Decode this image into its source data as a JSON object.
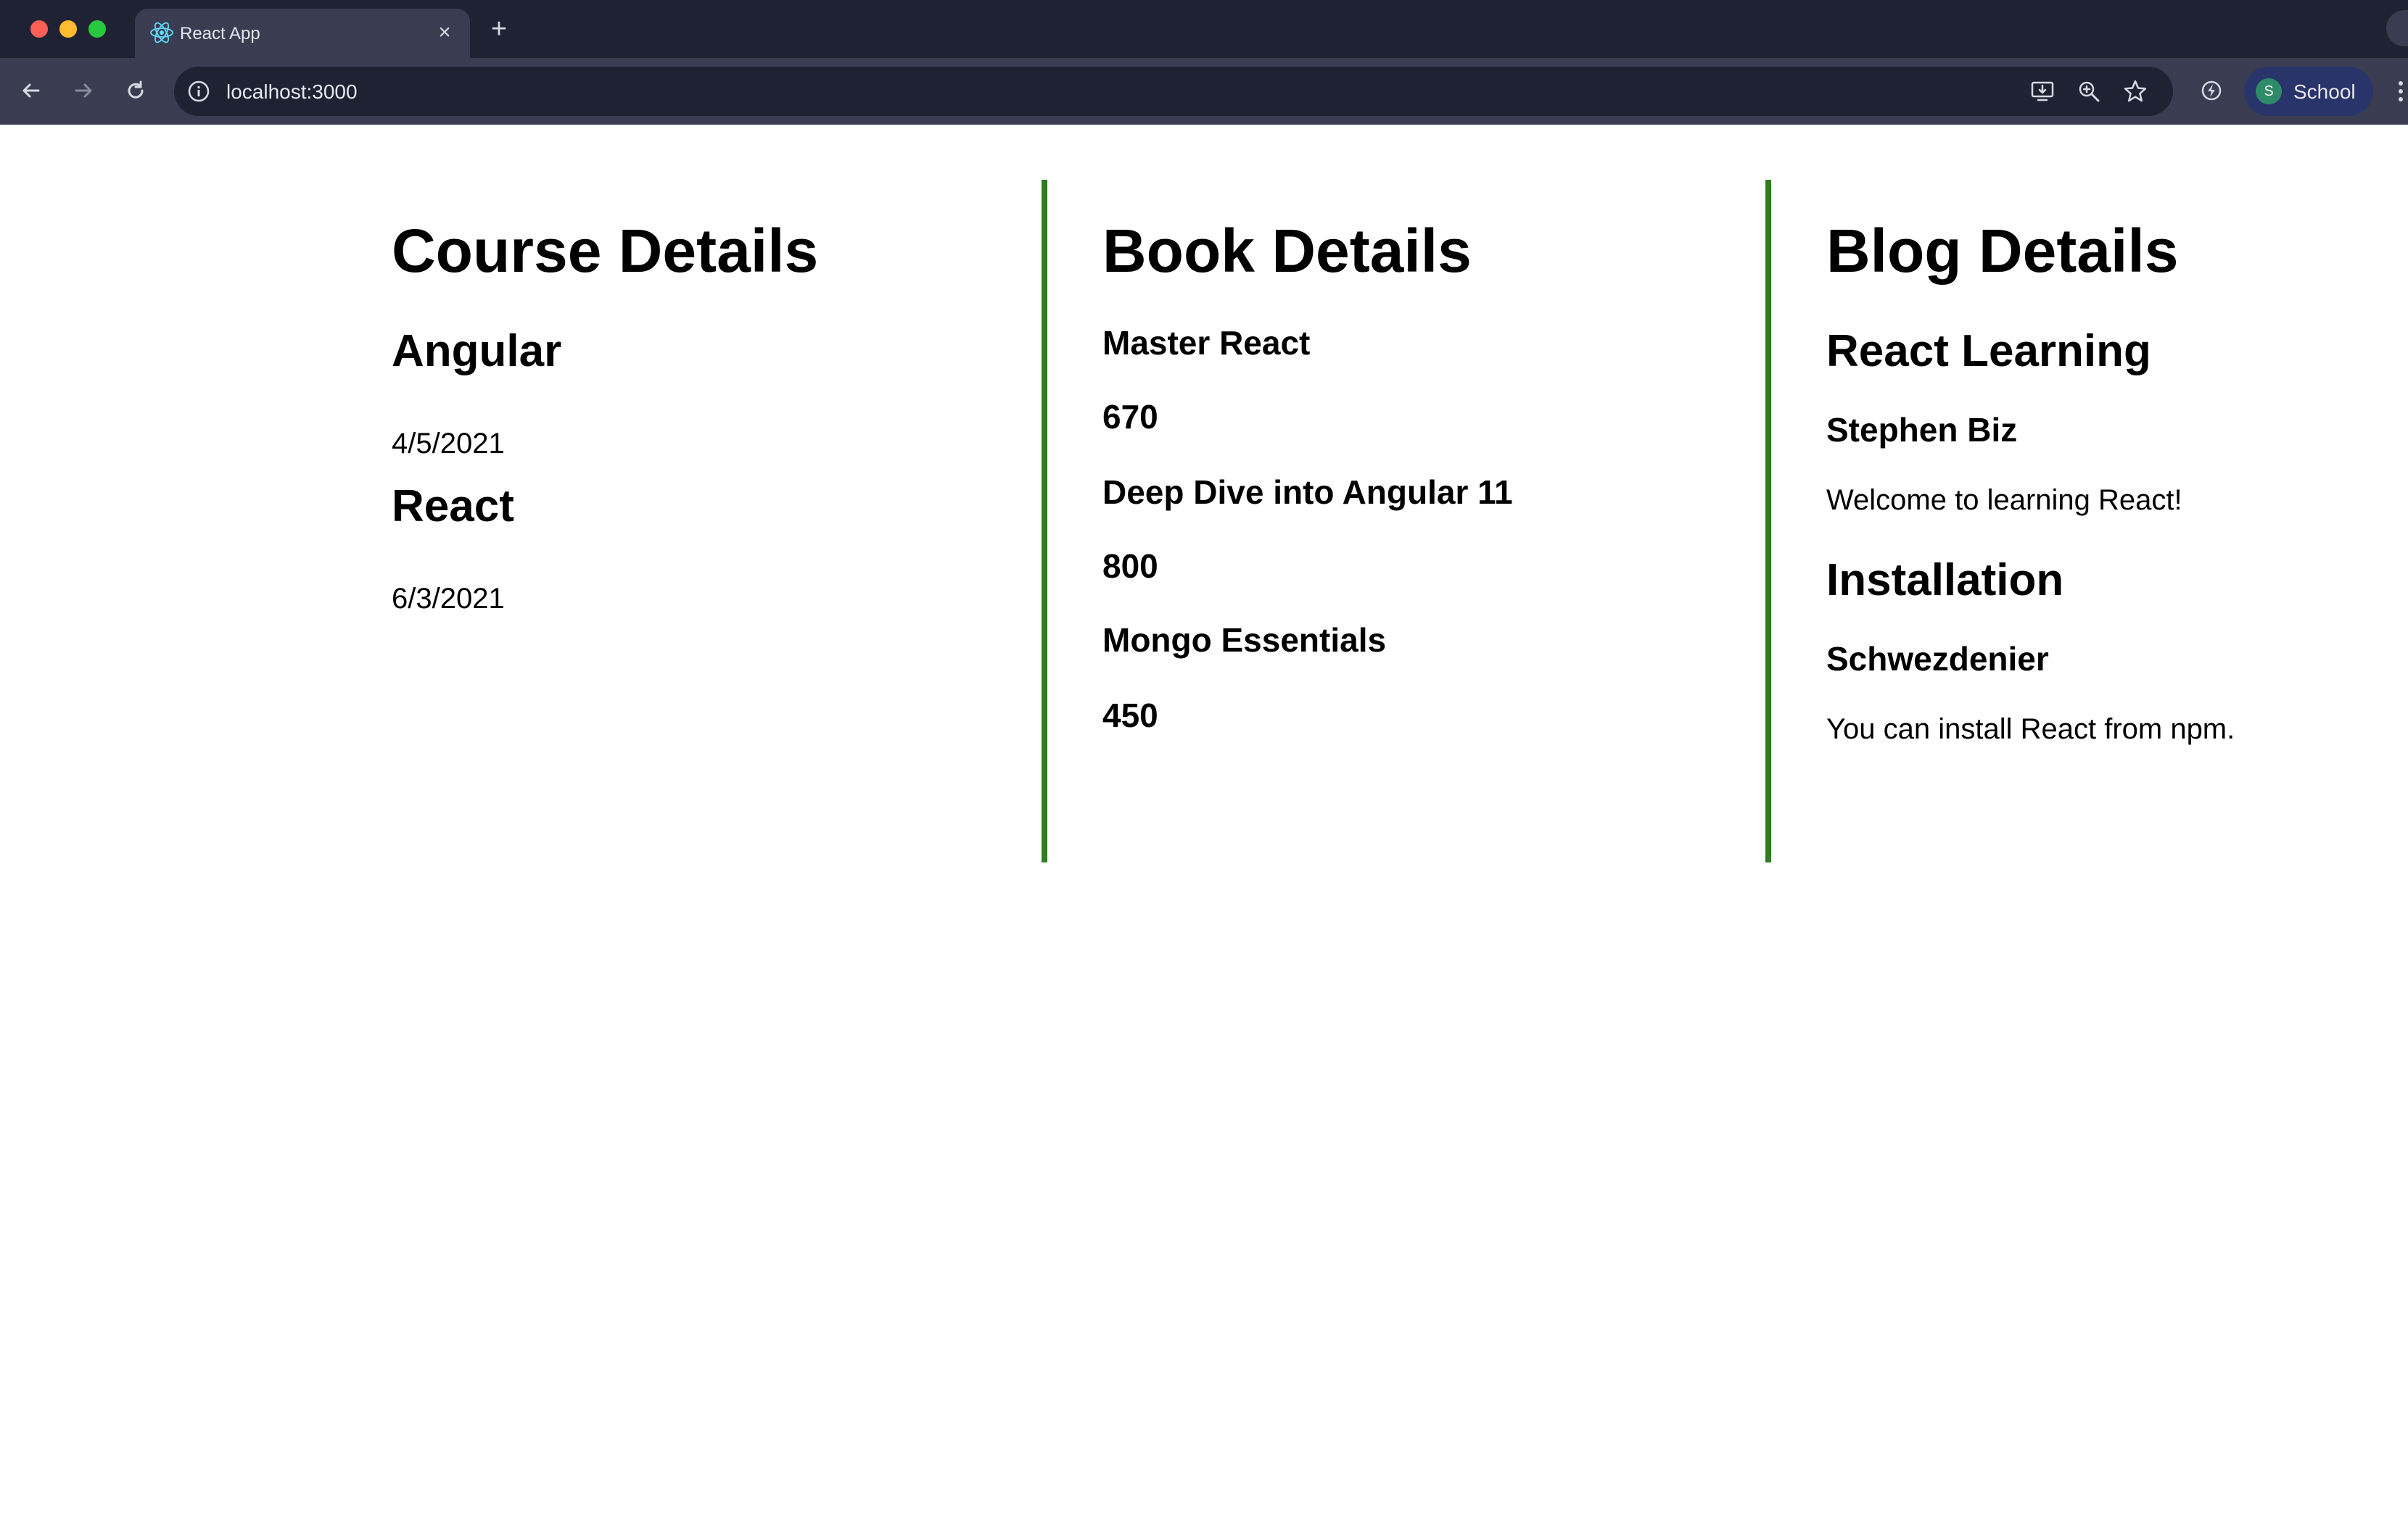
{
  "browser": {
    "tab_title": "React App",
    "url": "localhost:3000",
    "profile_initial": "S",
    "profile_name": "School"
  },
  "course_details": {
    "heading": "Course Details",
    "courses": [
      {
        "name": "Angular",
        "date": "4/5/2021"
      },
      {
        "name": "React",
        "date": "6/3/2021"
      }
    ]
  },
  "book_details": {
    "heading": "Book Details",
    "books": [
      {
        "name": "Master React",
        "price": "670"
      },
      {
        "name": "Deep Dive into Angular 11",
        "price": "800"
      },
      {
        "name": "Mongo Essentials",
        "price": "450"
      }
    ]
  },
  "blog_details": {
    "heading": "Blog Details",
    "blogs": [
      {
        "title": "React Learning",
        "author": "Stephen Biz",
        "content": "Welcome to learning React!"
      },
      {
        "title": "Installation",
        "author": "Schwezdenier",
        "content": "You can install React from npm."
      }
    ]
  },
  "colors": {
    "column_divider": "#2e7d1f",
    "chrome_dark": "#1f2233",
    "chrome_toolbar": "#3a3d51"
  }
}
